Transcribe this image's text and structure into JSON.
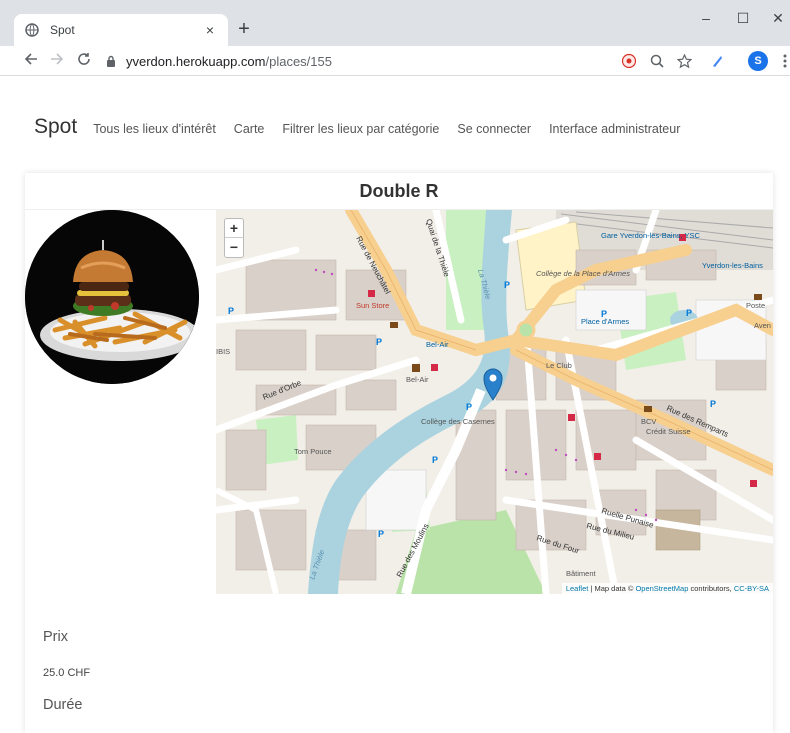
{
  "browser": {
    "tab_title": "Spot",
    "url_host": "yverdon.herokuapp.com",
    "url_path": "/places/155",
    "profile_initial": "S",
    "new_tab_label": "+",
    "close_tab_label": "×",
    "minimize_label": "–",
    "maximize_label": "☐",
    "close_window_label": "✕"
  },
  "nav": {
    "brand": "Spot",
    "links": [
      "Tous les lieux d'intérêt",
      "Carte",
      "Filtrer les lieux par catégorie",
      "Se connecter",
      "Interface administrateur"
    ]
  },
  "place": {
    "name": "Double R",
    "price_label": "Prix",
    "price_value": "25.0 CHF",
    "duration_label": "Durée"
  },
  "map": {
    "zoom_in": "+",
    "zoom_out": "−",
    "attribution_leaflet": "Leaflet",
    "attribution_text": " | Map data © ",
    "attribution_osm": "OpenStreetMap",
    "attribution_contrib": " contributors, ",
    "attribution_license": "CC-BY-SA",
    "labels": {
      "gare": "Gare Yverdon-les-Bains, YSC",
      "college_place": "Collège de la Place d'Armes",
      "place_armes": "Place d'Armes",
      "rue_neuchatel": "Rue de Neuchâtel",
      "quai_thiele": "Quai de la Thièle",
      "la_thiele": "La Thièle",
      "sun_store": "Sun Store",
      "bel_air": "Bel-Air",
      "bel_air2": "Bel-Air",
      "le_club": "Le Club",
      "rue_orbe": "Rue d'Orbe",
      "college_casernes": "Collège des Casernes",
      "tom_pouce": "Tom Pouce",
      "rue_remparts": "Rue des Remparts",
      "bcv": "BCV",
      "credit_suisse": "Crédit Suisse",
      "ruelle_punaise": "Ruelle Punaise",
      "rue_milieu": "Rue du Milieu",
      "rue_four": "Rue du Four",
      "rue_moulins": "Rue des Moulins",
      "poste": "Poste",
      "yverdon_bains": "Yverdon-les-Bains",
      "batiment": "Bâtiment",
      "la_thiele2": "La Thièle",
      "ibis": "IBIS",
      "aven": "Aven"
    }
  },
  "colors": {
    "accent": "#2a81cb",
    "road_major": "#f7cf8f",
    "water": "#aad3df",
    "park": "#b9e3a8"
  }
}
